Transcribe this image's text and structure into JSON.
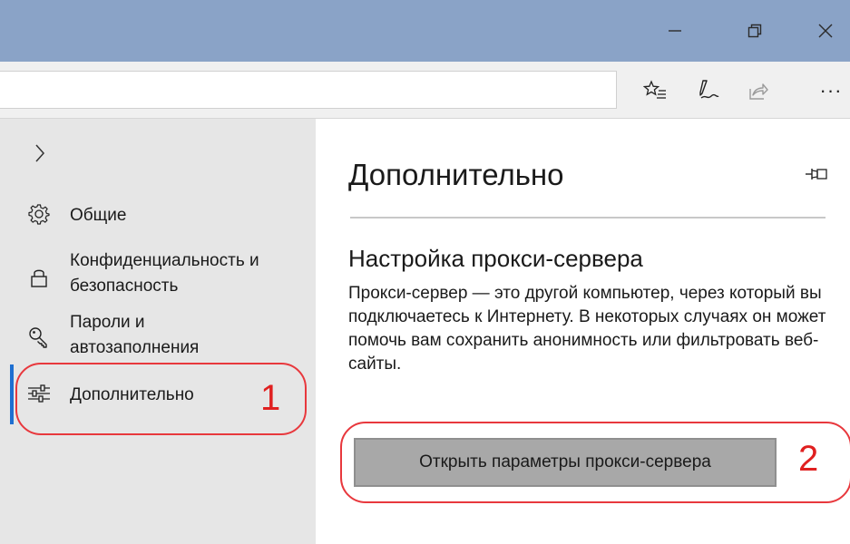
{
  "window": {
    "minimize_icon": "minimize-icon",
    "restore_icon": "restore-icon",
    "close_icon": "close-icon",
    "titlebar_color": "#8aa3c7"
  },
  "toolbar": {
    "favorites_icon": "favorites-list-icon",
    "notes_icon": "web-note-pen-icon",
    "share_icon": "share-icon",
    "more_label": "···"
  },
  "sidebar": {
    "expand_icon": "chevron-right-icon",
    "items": [
      {
        "icon": "gear-icon",
        "label": "Общие"
      },
      {
        "icon": "lock-icon",
        "label_line1": "Конфиденциальность и",
        "label_line2": "безопасность"
      },
      {
        "icon": "key-icon",
        "label_line1": "Пароли и",
        "label_line2": "автозаполнения"
      },
      {
        "icon": "sliders-icon",
        "label": "Дополнительно",
        "selected": true
      }
    ],
    "selected_color": "#1f6fd1"
  },
  "panel": {
    "title": "Дополнительно",
    "pin_icon": "pin-icon",
    "section_title": "Настройка прокси-сервера",
    "description": "Прокси-сервер — это другой компьютер, через который вы подключаетесь к Интернету. В некоторых случаях он может помочь вам сохранить анонимность или фильтровать веб-сайты.",
    "button_label": "Открыть параметры прокси-сервера"
  },
  "annotations": {
    "step1": "1",
    "step2": "2",
    "color": "#e02020"
  }
}
